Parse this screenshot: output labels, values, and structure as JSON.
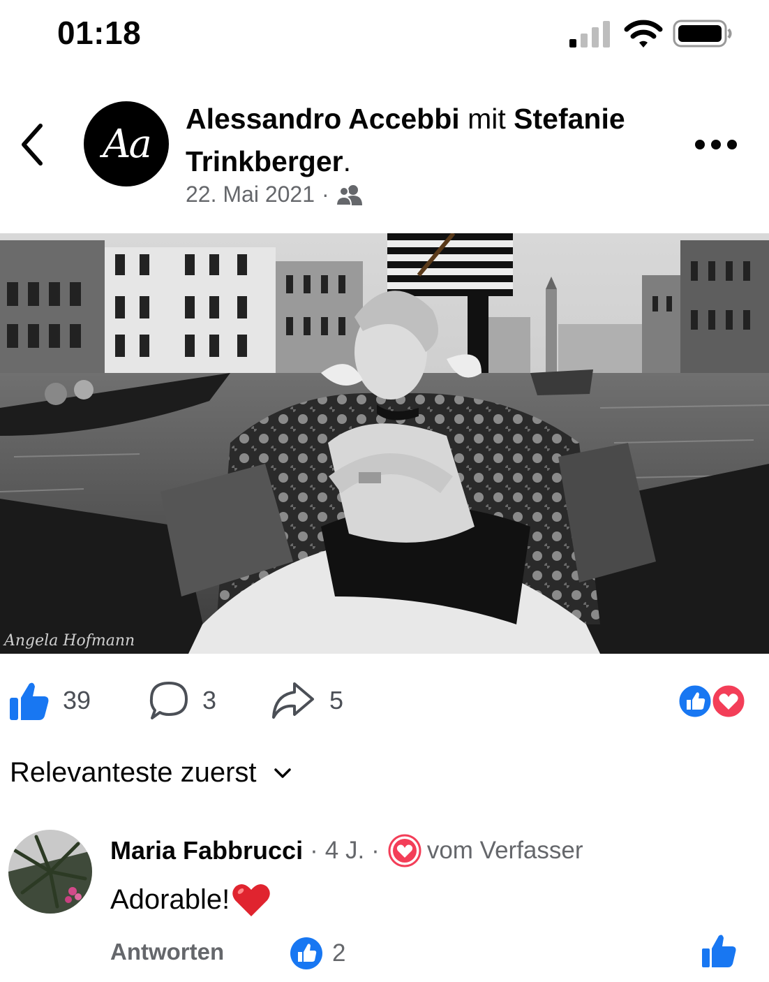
{
  "status_bar": {
    "time": "01:18",
    "icons": [
      "signal-icon",
      "wifi-icon",
      "battery-icon"
    ]
  },
  "post": {
    "author": "Alessandro Accebbi",
    "connector": "mit",
    "tagged_line1": "Stefanie",
    "tagged_line2": "Trinkberger",
    "period": ".",
    "author_initials": "Aa",
    "date": "22. Mai 2021",
    "meta_separator": "·",
    "audience_icon": "friends-icon",
    "photo_watermark": "Angela Hofmann",
    "photo_description_icon": "photo"
  },
  "actions": {
    "likes": "39",
    "comments": "3",
    "shares": "5",
    "reaction_types": [
      "like",
      "love"
    ]
  },
  "sort": {
    "label": "Relevanteste zuerst"
  },
  "comment": {
    "author": "Maria Fabbrucci",
    "time": "4 J.",
    "separator": "·",
    "badge": "vom Verfasser",
    "text": "Adorable!",
    "reply_label": "Antworten",
    "like_count": "2"
  },
  "colors": {
    "facebook_blue": "#1877f2",
    "love_red": "#f33e58",
    "secondary_text": "#65676b"
  }
}
